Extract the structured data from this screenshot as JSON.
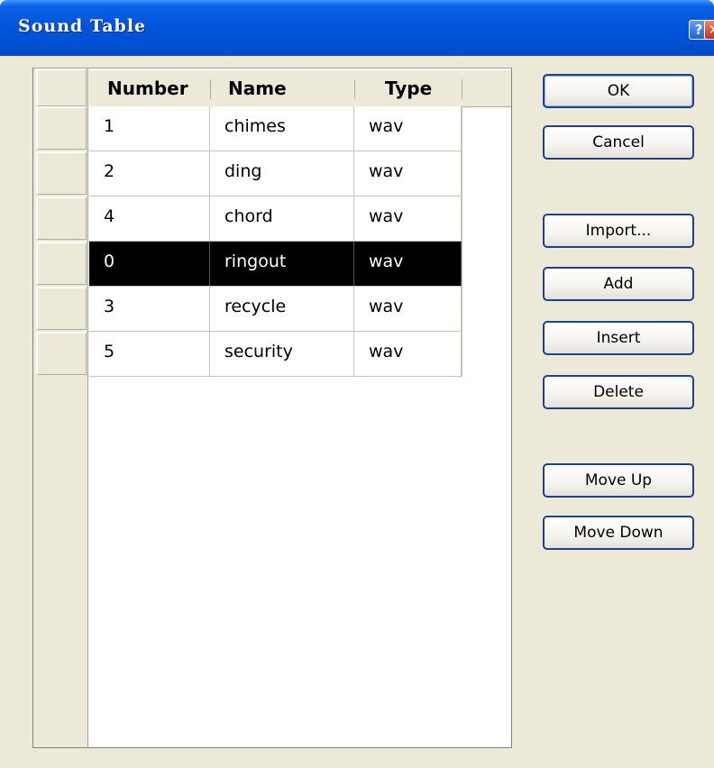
{
  "window": {
    "title": "Sound Table",
    "help_label": "?",
    "close_label": "✕"
  },
  "table": {
    "columns": [
      "Number",
      "Name",
      "Type"
    ],
    "rows": [
      {
        "number": "1",
        "name": "chimes",
        "type": "wav"
      },
      {
        "number": "2",
        "name": "ding",
        "type": "wav"
      },
      {
        "number": "4",
        "name": "chord",
        "type": "wav"
      },
      {
        "number": "0",
        "name": "ringout",
        "type": "wav"
      },
      {
        "number": "3",
        "name": "recycle",
        "type": "wav"
      },
      {
        "number": "5",
        "name": "security",
        "type": "wav"
      }
    ],
    "selected_row": "ringout"
  },
  "buttons": {
    "ok": "OK",
    "cancel": "Cancel",
    "import": "Import...",
    "add": "Add",
    "insert": "Insert",
    "delete": "Delete",
    "move_up": "Move Up",
    "move_down": "Move Down"
  },
  "colors": {
    "titlebar": "#0054e3",
    "dialog_bg": "#ece9d8",
    "selection": "#000000"
  }
}
